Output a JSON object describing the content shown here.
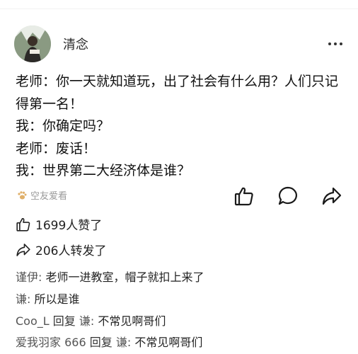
{
  "author": {
    "name": "清念"
  },
  "post": {
    "lines": [
      "老师：你一天就知道玩，出了社会有什么用？人们只记得第一名！",
      "我：你确定吗？",
      "老师：废话！",
      "我：世界第二大经济体是谁？"
    ]
  },
  "tag": {
    "label": "空友爱看"
  },
  "stats": {
    "likes": "1699人赞了",
    "reposts": "206人转发了"
  },
  "comments": [
    {
      "nick": "谨伊:",
      "text": " 老师一进教室，帽子就扣上来了"
    },
    {
      "nick": "谦:",
      "text": " 所以是谁"
    },
    {
      "nick": "Coo_L",
      "reply_label": " 回复 ",
      "target": "谦:",
      "text": " 不常见啊哥们"
    },
    {
      "nick": "爱我羽家 666",
      "reply_label": " 回复 ",
      "target": "谦:",
      "text": " 不常见啊哥们"
    }
  ],
  "colors": {
    "text": "#111111",
    "muted": "#9a9a9a",
    "icon": "#1a1a1a"
  }
}
